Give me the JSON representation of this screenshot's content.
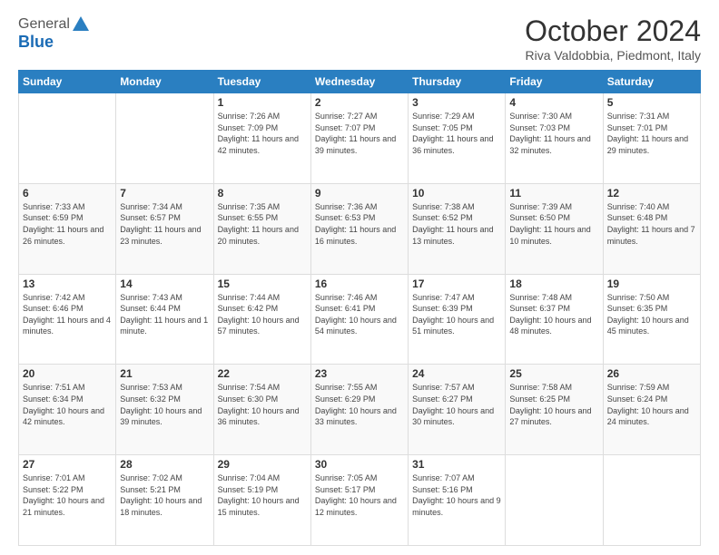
{
  "header": {
    "logo_general": "General",
    "logo_blue": "Blue",
    "month_title": "October 2024",
    "location": "Riva Valdobbia, Piedmont, Italy"
  },
  "weekdays": [
    "Sunday",
    "Monday",
    "Tuesday",
    "Wednesday",
    "Thursday",
    "Friday",
    "Saturday"
  ],
  "weeks": [
    [
      {
        "day": "",
        "sunrise": "",
        "sunset": "",
        "daylight": ""
      },
      {
        "day": "",
        "sunrise": "",
        "sunset": "",
        "daylight": ""
      },
      {
        "day": "1",
        "sunrise": "Sunrise: 7:26 AM",
        "sunset": "Sunset: 7:09 PM",
        "daylight": "Daylight: 11 hours and 42 minutes."
      },
      {
        "day": "2",
        "sunrise": "Sunrise: 7:27 AM",
        "sunset": "Sunset: 7:07 PM",
        "daylight": "Daylight: 11 hours and 39 minutes."
      },
      {
        "day": "3",
        "sunrise": "Sunrise: 7:29 AM",
        "sunset": "Sunset: 7:05 PM",
        "daylight": "Daylight: 11 hours and 36 minutes."
      },
      {
        "day": "4",
        "sunrise": "Sunrise: 7:30 AM",
        "sunset": "Sunset: 7:03 PM",
        "daylight": "Daylight: 11 hours and 32 minutes."
      },
      {
        "day": "5",
        "sunrise": "Sunrise: 7:31 AM",
        "sunset": "Sunset: 7:01 PM",
        "daylight": "Daylight: 11 hours and 29 minutes."
      }
    ],
    [
      {
        "day": "6",
        "sunrise": "Sunrise: 7:33 AM",
        "sunset": "Sunset: 6:59 PM",
        "daylight": "Daylight: 11 hours and 26 minutes."
      },
      {
        "day": "7",
        "sunrise": "Sunrise: 7:34 AM",
        "sunset": "Sunset: 6:57 PM",
        "daylight": "Daylight: 11 hours and 23 minutes."
      },
      {
        "day": "8",
        "sunrise": "Sunrise: 7:35 AM",
        "sunset": "Sunset: 6:55 PM",
        "daylight": "Daylight: 11 hours and 20 minutes."
      },
      {
        "day": "9",
        "sunrise": "Sunrise: 7:36 AM",
        "sunset": "Sunset: 6:53 PM",
        "daylight": "Daylight: 11 hours and 16 minutes."
      },
      {
        "day": "10",
        "sunrise": "Sunrise: 7:38 AM",
        "sunset": "Sunset: 6:52 PM",
        "daylight": "Daylight: 11 hours and 13 minutes."
      },
      {
        "day": "11",
        "sunrise": "Sunrise: 7:39 AM",
        "sunset": "Sunset: 6:50 PM",
        "daylight": "Daylight: 11 hours and 10 minutes."
      },
      {
        "day": "12",
        "sunrise": "Sunrise: 7:40 AM",
        "sunset": "Sunset: 6:48 PM",
        "daylight": "Daylight: 11 hours and 7 minutes."
      }
    ],
    [
      {
        "day": "13",
        "sunrise": "Sunrise: 7:42 AM",
        "sunset": "Sunset: 6:46 PM",
        "daylight": "Daylight: 11 hours and 4 minutes."
      },
      {
        "day": "14",
        "sunrise": "Sunrise: 7:43 AM",
        "sunset": "Sunset: 6:44 PM",
        "daylight": "Daylight: 11 hours and 1 minute."
      },
      {
        "day": "15",
        "sunrise": "Sunrise: 7:44 AM",
        "sunset": "Sunset: 6:42 PM",
        "daylight": "Daylight: 10 hours and 57 minutes."
      },
      {
        "day": "16",
        "sunrise": "Sunrise: 7:46 AM",
        "sunset": "Sunset: 6:41 PM",
        "daylight": "Daylight: 10 hours and 54 minutes."
      },
      {
        "day": "17",
        "sunrise": "Sunrise: 7:47 AM",
        "sunset": "Sunset: 6:39 PM",
        "daylight": "Daylight: 10 hours and 51 minutes."
      },
      {
        "day": "18",
        "sunrise": "Sunrise: 7:48 AM",
        "sunset": "Sunset: 6:37 PM",
        "daylight": "Daylight: 10 hours and 48 minutes."
      },
      {
        "day": "19",
        "sunrise": "Sunrise: 7:50 AM",
        "sunset": "Sunset: 6:35 PM",
        "daylight": "Daylight: 10 hours and 45 minutes."
      }
    ],
    [
      {
        "day": "20",
        "sunrise": "Sunrise: 7:51 AM",
        "sunset": "Sunset: 6:34 PM",
        "daylight": "Daylight: 10 hours and 42 minutes."
      },
      {
        "day": "21",
        "sunrise": "Sunrise: 7:53 AM",
        "sunset": "Sunset: 6:32 PM",
        "daylight": "Daylight: 10 hours and 39 minutes."
      },
      {
        "day": "22",
        "sunrise": "Sunrise: 7:54 AM",
        "sunset": "Sunset: 6:30 PM",
        "daylight": "Daylight: 10 hours and 36 minutes."
      },
      {
        "day": "23",
        "sunrise": "Sunrise: 7:55 AM",
        "sunset": "Sunset: 6:29 PM",
        "daylight": "Daylight: 10 hours and 33 minutes."
      },
      {
        "day": "24",
        "sunrise": "Sunrise: 7:57 AM",
        "sunset": "Sunset: 6:27 PM",
        "daylight": "Daylight: 10 hours and 30 minutes."
      },
      {
        "day": "25",
        "sunrise": "Sunrise: 7:58 AM",
        "sunset": "Sunset: 6:25 PM",
        "daylight": "Daylight: 10 hours and 27 minutes."
      },
      {
        "day": "26",
        "sunrise": "Sunrise: 7:59 AM",
        "sunset": "Sunset: 6:24 PM",
        "daylight": "Daylight: 10 hours and 24 minutes."
      }
    ],
    [
      {
        "day": "27",
        "sunrise": "Sunrise: 7:01 AM",
        "sunset": "Sunset: 5:22 PM",
        "daylight": "Daylight: 10 hours and 21 minutes."
      },
      {
        "day": "28",
        "sunrise": "Sunrise: 7:02 AM",
        "sunset": "Sunset: 5:21 PM",
        "daylight": "Daylight: 10 hours and 18 minutes."
      },
      {
        "day": "29",
        "sunrise": "Sunrise: 7:04 AM",
        "sunset": "Sunset: 5:19 PM",
        "daylight": "Daylight: 10 hours and 15 minutes."
      },
      {
        "day": "30",
        "sunrise": "Sunrise: 7:05 AM",
        "sunset": "Sunset: 5:17 PM",
        "daylight": "Daylight: 10 hours and 12 minutes."
      },
      {
        "day": "31",
        "sunrise": "Sunrise: 7:07 AM",
        "sunset": "Sunset: 5:16 PM",
        "daylight": "Daylight: 10 hours and 9 minutes."
      },
      {
        "day": "",
        "sunrise": "",
        "sunset": "",
        "daylight": ""
      },
      {
        "day": "",
        "sunrise": "",
        "sunset": "",
        "daylight": ""
      }
    ]
  ]
}
